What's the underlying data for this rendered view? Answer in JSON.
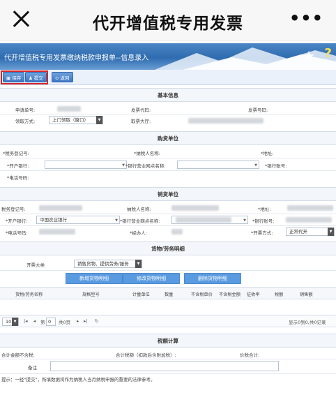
{
  "header": {
    "title": "代开增值税专用发票",
    "more_icon": "ellipsis-icon"
  },
  "banner": {
    "title": "代开增值税专用发票缴纳税款申报单--信息录入"
  },
  "toolbar": {
    "save": "保存",
    "submit": "提交",
    "back": "返回"
  },
  "basic": {
    "title": "基本信息",
    "apply_no_label": "申请单号:",
    "invoice_code_label": "发票代码:",
    "invoice_no_label": "发票号码:",
    "receive_label": "领取方式:",
    "receive_value": "上门领取（窗口）",
    "hall_label": "取票大厅:"
  },
  "buyer": {
    "title": "购货单位",
    "tax_no_label": "*税务登记号:",
    "taxpayer_name_label": "*纳税人名称:",
    "address_label": "*地址:",
    "bank_label": "*开户银行:",
    "branch_label": "*银行营业网点名称:",
    "account_label": "*银行账号:",
    "phone_label": "*电话号码:"
  },
  "seller": {
    "title": "销货单位",
    "tax_no_label": "税务登记号:",
    "taxpayer_name_label": "纳税人名称:",
    "address_label": "*地址:",
    "bank_label": "*开户银行:",
    "bank_value": "中国农业银行",
    "branch_label": "*银行营业网点名称:",
    "account_label": "*银行账号:",
    "phone_label": "*电话号码:",
    "agent_label": "*经办人:",
    "mode_label": "*开票方式:",
    "mode_value": "正常代开"
  },
  "goods": {
    "title": "货物/劳务明细",
    "category_label": "开票大类",
    "category_value": "销售货物、提供劳务/服务",
    "add_btn": "新增货物明细",
    "edit_btn": "修改货物明细",
    "delete_btn": "删除货物明细",
    "columns": [
      "货物/劳务名称",
      "规格型号",
      "计量单位",
      "数量",
      "不含税单价",
      "不含税金额",
      "征收率",
      "税额",
      "销售额"
    ]
  },
  "pager": {
    "page_size": "10",
    "page_prefix": "第",
    "page_value": "0",
    "page_suffix": "共0页",
    "summary": "显示0到0,共0记录"
  },
  "tax": {
    "title": "税额计算",
    "total_excl_label": "合计金额不含税:",
    "total_tax_label": "合计税额（扣款后含附加税）:",
    "price_tax_label": "价税合计:",
    "remark_label": "备注"
  },
  "tip": "提示：一经\"提交\"，所填数据将作为纳税人当月纳税申报的重要的法律参考。"
}
